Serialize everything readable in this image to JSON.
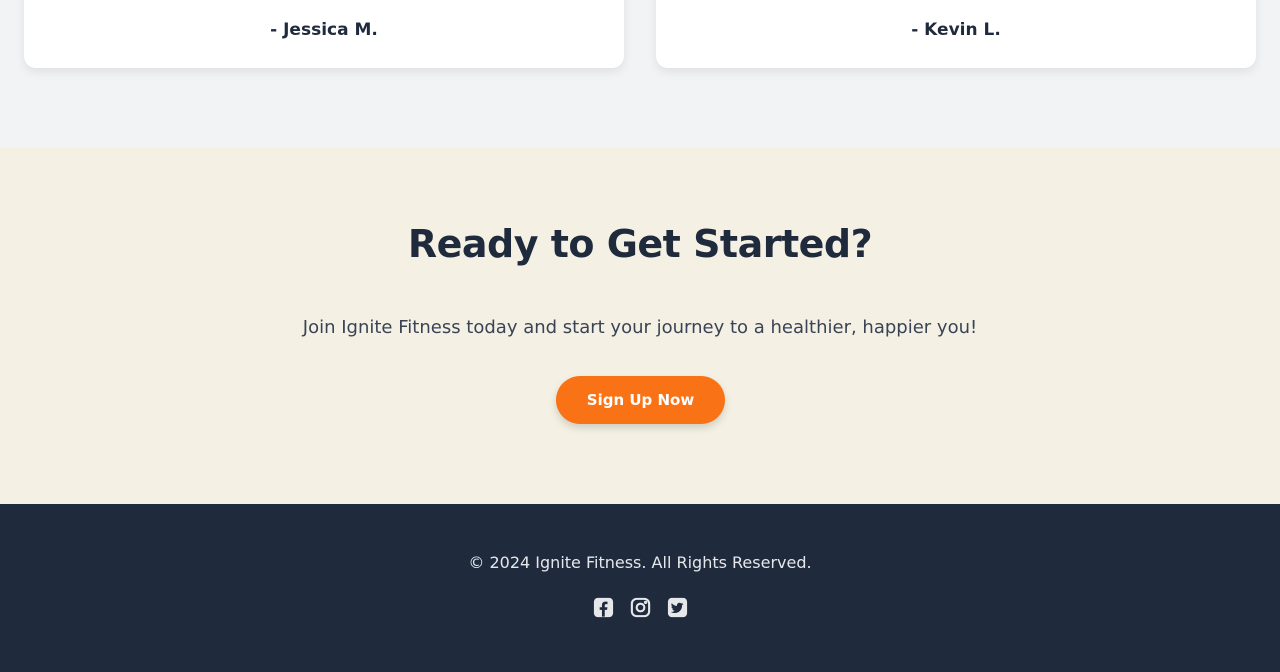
{
  "testimonials": {
    "items": [
      {
        "author": "- Jessica M."
      },
      {
        "author": "- Kevin L."
      }
    ]
  },
  "cta": {
    "title": "Ready to Get Started?",
    "text": "Join Ignite Fitness today and start your journey to a healthier, happier you!",
    "button_label": "Sign Up Now"
  },
  "footer": {
    "copyright": "© 2024 Ignite Fitness. All Rights Reserved.",
    "social": [
      "facebook-icon",
      "instagram-icon",
      "twitter-icon"
    ]
  },
  "colors": {
    "accent": "#f97316",
    "dark": "#1f2a3d",
    "cta_background": "#f4f1e4",
    "page_background": "#f2f3f5"
  }
}
